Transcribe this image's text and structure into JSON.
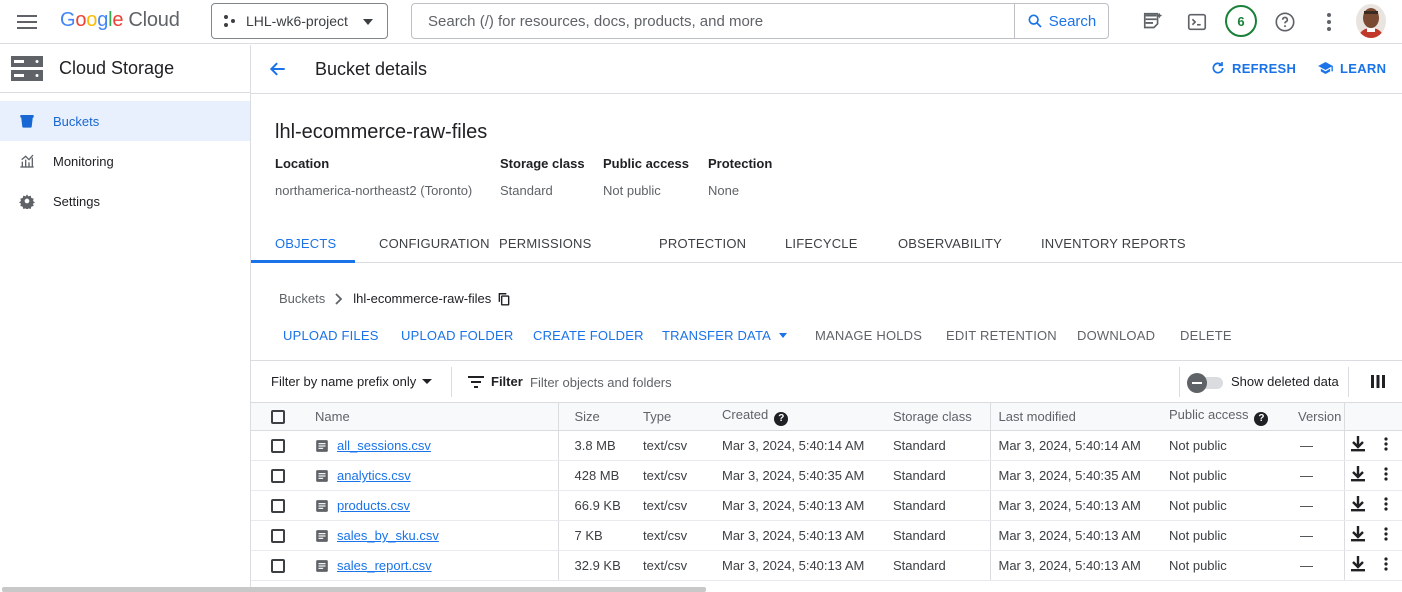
{
  "header": {
    "project": "LHL-wk6-project",
    "search_placeholder": "Search (/) for resources, docs, products, and more",
    "search_button": "Search",
    "notification_count": "6"
  },
  "sidebar": {
    "product": "Cloud Storage",
    "items": [
      {
        "label": "Buckets",
        "icon": "bucket-icon",
        "active": true
      },
      {
        "label": "Monitoring",
        "icon": "monitoring-icon"
      },
      {
        "label": "Settings",
        "icon": "settings-icon"
      }
    ]
  },
  "page": {
    "title": "Bucket details",
    "refresh": "REFRESH",
    "learn": "LEARN"
  },
  "bucket": {
    "name": "lhl-ecommerce-raw-files",
    "props": [
      {
        "label": "Location",
        "value": "northamerica-northeast2 (Toronto)"
      },
      {
        "label": "Storage class",
        "value": "Standard"
      },
      {
        "label": "Public access",
        "value": "Not public"
      },
      {
        "label": "Protection",
        "value": "None"
      }
    ]
  },
  "tabs": [
    "OBJECTS",
    "CONFIGURATION",
    "PERMISSIONS",
    "PROTECTION",
    "LIFECYCLE",
    "OBSERVABILITY",
    "INVENTORY REPORTS"
  ],
  "breadcrumb": {
    "root": "Buckets",
    "current": "lhl-ecommerce-raw-files"
  },
  "actions": [
    "UPLOAD FILES",
    "UPLOAD FOLDER",
    "CREATE FOLDER",
    "TRANSFER DATA",
    "MANAGE HOLDS",
    "EDIT RETENTION",
    "DOWNLOAD",
    "DELETE"
  ],
  "filter": {
    "mode": "Filter by name prefix only",
    "label": "Filter",
    "placeholder": "Filter objects and folders",
    "show_deleted": "Show deleted data"
  },
  "table": {
    "columns": [
      "Name",
      "Size",
      "Type",
      "Created",
      "Storage class",
      "Last modified",
      "Public access",
      "Version"
    ],
    "rows": [
      {
        "name": "all_sessions.csv",
        "size": "3.8 MB",
        "type": "text/csv",
        "created": "Mar 3, 2024, 5:40:14 AM",
        "storage": "Standard",
        "modified": "Mar 3, 2024, 5:40:14 AM",
        "access": "Not public",
        "version": "—"
      },
      {
        "name": "analytics.csv",
        "size": "428 MB",
        "type": "text/csv",
        "created": "Mar 3, 2024, 5:40:35 AM",
        "storage": "Standard",
        "modified": "Mar 3, 2024, 5:40:35 AM",
        "access": "Not public",
        "version": "—"
      },
      {
        "name": "products.csv",
        "size": "66.9 KB",
        "type": "text/csv",
        "created": "Mar 3, 2024, 5:40:13 AM",
        "storage": "Standard",
        "modified": "Mar 3, 2024, 5:40:13 AM",
        "access": "Not public",
        "version": "—"
      },
      {
        "name": "sales_by_sku.csv",
        "size": "7 KB",
        "type": "text/csv",
        "created": "Mar 3, 2024, 5:40:13 AM",
        "storage": "Standard",
        "modified": "Mar 3, 2024, 5:40:13 AM",
        "access": "Not public",
        "version": "—"
      },
      {
        "name": "sales_report.csv",
        "size": "32.9 KB",
        "type": "text/csv",
        "created": "Mar 3, 2024, 5:40:13 AM",
        "storage": "Standard",
        "modified": "Mar 3, 2024, 5:40:13 AM",
        "access": "Not public",
        "version": "—"
      }
    ]
  },
  "colors": {
    "accent": "#1a73e8",
    "active_bg": "#e8f0fe",
    "badge": "#188038"
  }
}
